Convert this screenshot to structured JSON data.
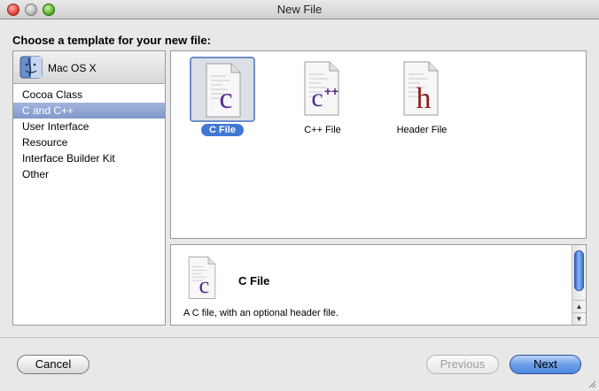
{
  "window": {
    "title": "New File"
  },
  "heading": "Choose a template for your new file:",
  "sidebar": {
    "group": "Mac OS X",
    "items": [
      {
        "label": "Cocoa Class",
        "selected": false
      },
      {
        "label": "C and C++",
        "selected": true
      },
      {
        "label": "User Interface",
        "selected": false
      },
      {
        "label": "Resource",
        "selected": false
      },
      {
        "label": "Interface Builder Kit",
        "selected": false
      },
      {
        "label": "Other",
        "selected": false
      }
    ]
  },
  "templates": [
    {
      "label": "C File",
      "glyph": "c",
      "selected": true
    },
    {
      "label": "C++ File",
      "glyph": "c++",
      "selected": false
    },
    {
      "label": "Header File",
      "glyph": "h",
      "selected": false
    }
  ],
  "description": {
    "title": "C File",
    "text": "A C file, with an optional header file."
  },
  "buttons": {
    "cancel": "Cancel",
    "previous": "Previous",
    "next": "Next"
  },
  "colors": {
    "selection": "#3f77d6",
    "glyph": "#5a2a8e",
    "header_glyph": "#8b1f1f"
  }
}
